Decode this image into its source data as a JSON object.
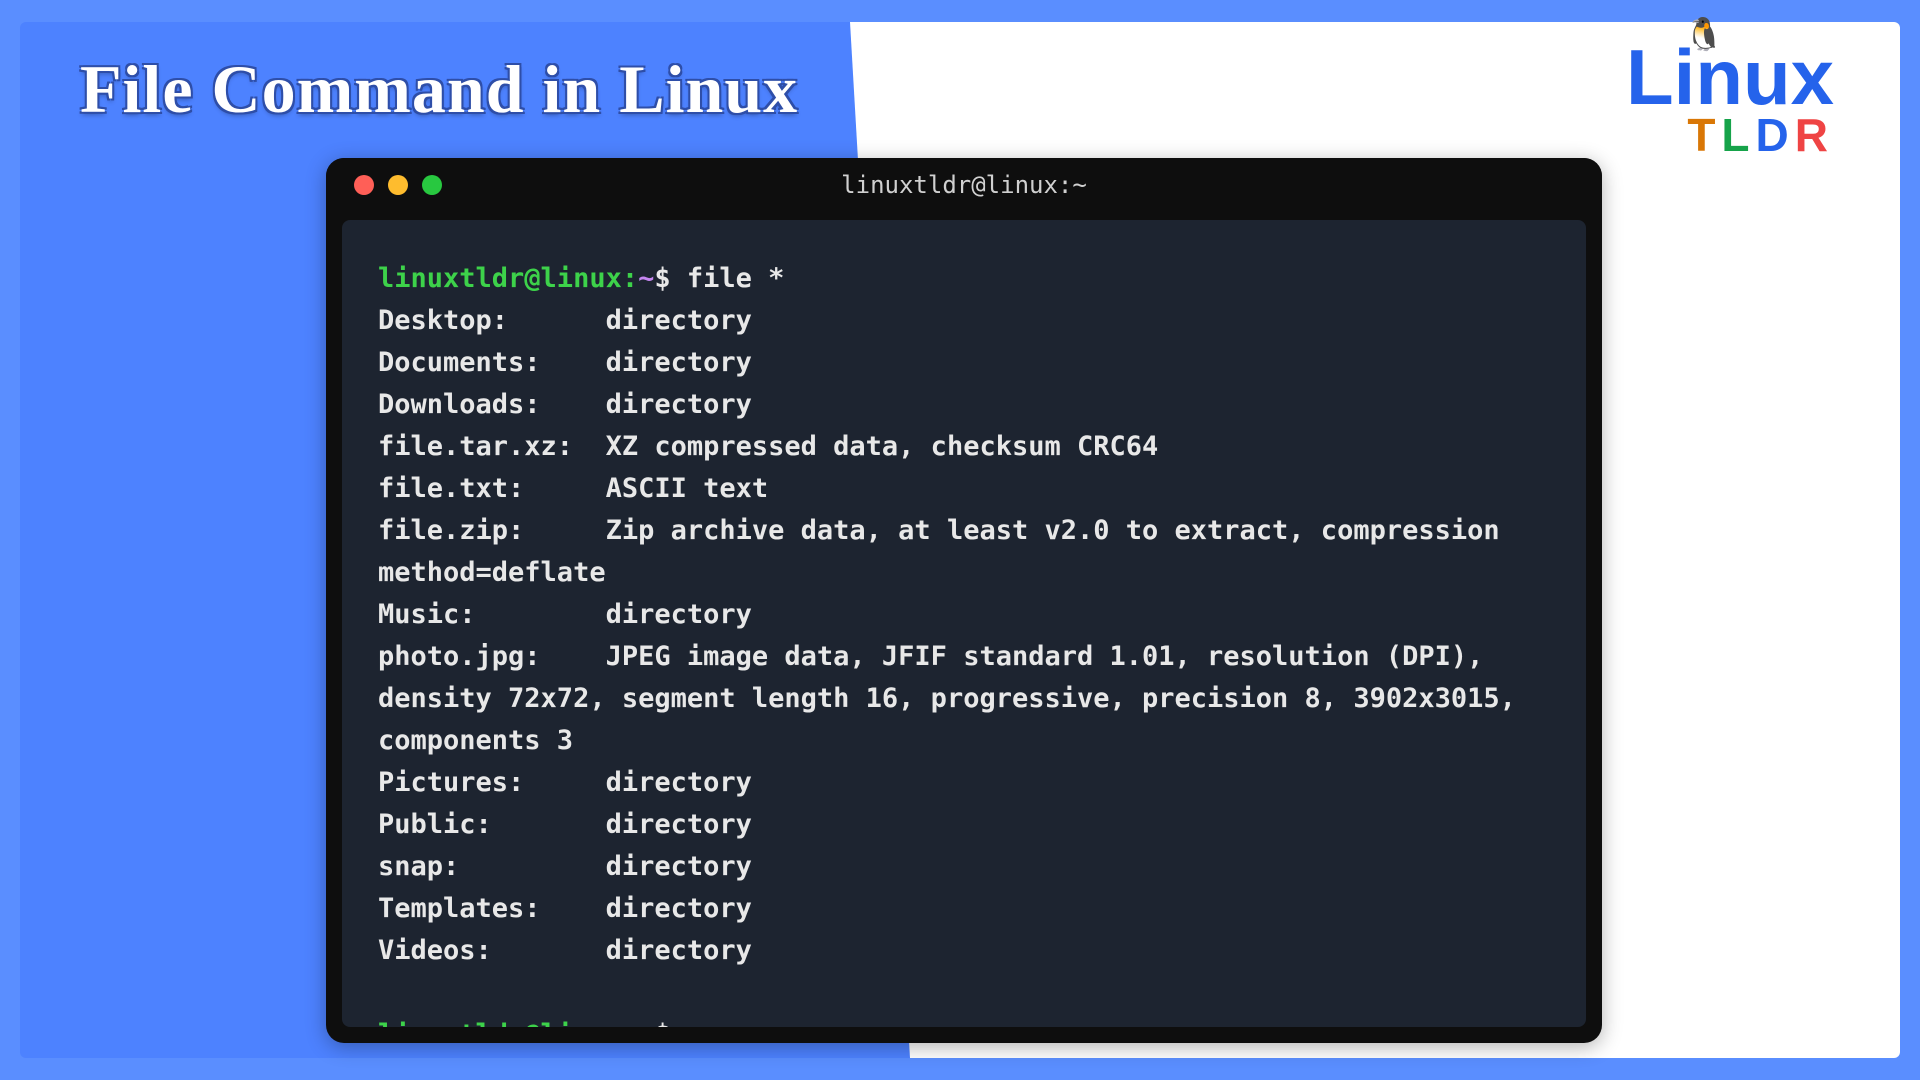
{
  "page": {
    "title": "File Command in Linux"
  },
  "logo": {
    "linux": "Linux",
    "tux_emoji": "🐧",
    "tldr": {
      "t": "T",
      "l": "L",
      "d": "D",
      "r": "R",
      "colors": {
        "t": "#d97706",
        "l": "#16a34a",
        "d": "#2563eb",
        "r": "#ef4444"
      }
    }
  },
  "terminal": {
    "window_title": "linuxtldr@linux:~",
    "prompt": {
      "user_host": "linuxtldr@linux:",
      "tilde": "~",
      "dollar": "$"
    },
    "command": "file *",
    "output": [
      {
        "name": "Desktop:",
        "type": "directory"
      },
      {
        "name": "Documents:",
        "type": "directory"
      },
      {
        "name": "Downloads:",
        "type": "directory"
      },
      {
        "name": "file.tar.xz:",
        "type": "XZ compressed data, checksum CRC64"
      },
      {
        "name": "file.txt:",
        "type": "ASCII text"
      },
      {
        "name": "file.zip:",
        "type": "Zip archive data, at least v2.0 to extract, compression method=deflate"
      },
      {
        "name": "Music:",
        "type": "directory"
      },
      {
        "name": "photo.jpg:",
        "type": "JPEG image data, JFIF standard 1.01, resolution (DPI), density 72x72, segment length 16, progressive, precision 8, 3902x3015, components 3"
      },
      {
        "name": "Pictures:",
        "type": "directory"
      },
      {
        "name": "Public:",
        "type": "directory"
      },
      {
        "name": "snap:",
        "type": "directory"
      },
      {
        "name": "Templates:",
        "type": "directory"
      },
      {
        "name": "Videos:",
        "type": "directory"
      }
    ],
    "name_col_width": 14
  }
}
